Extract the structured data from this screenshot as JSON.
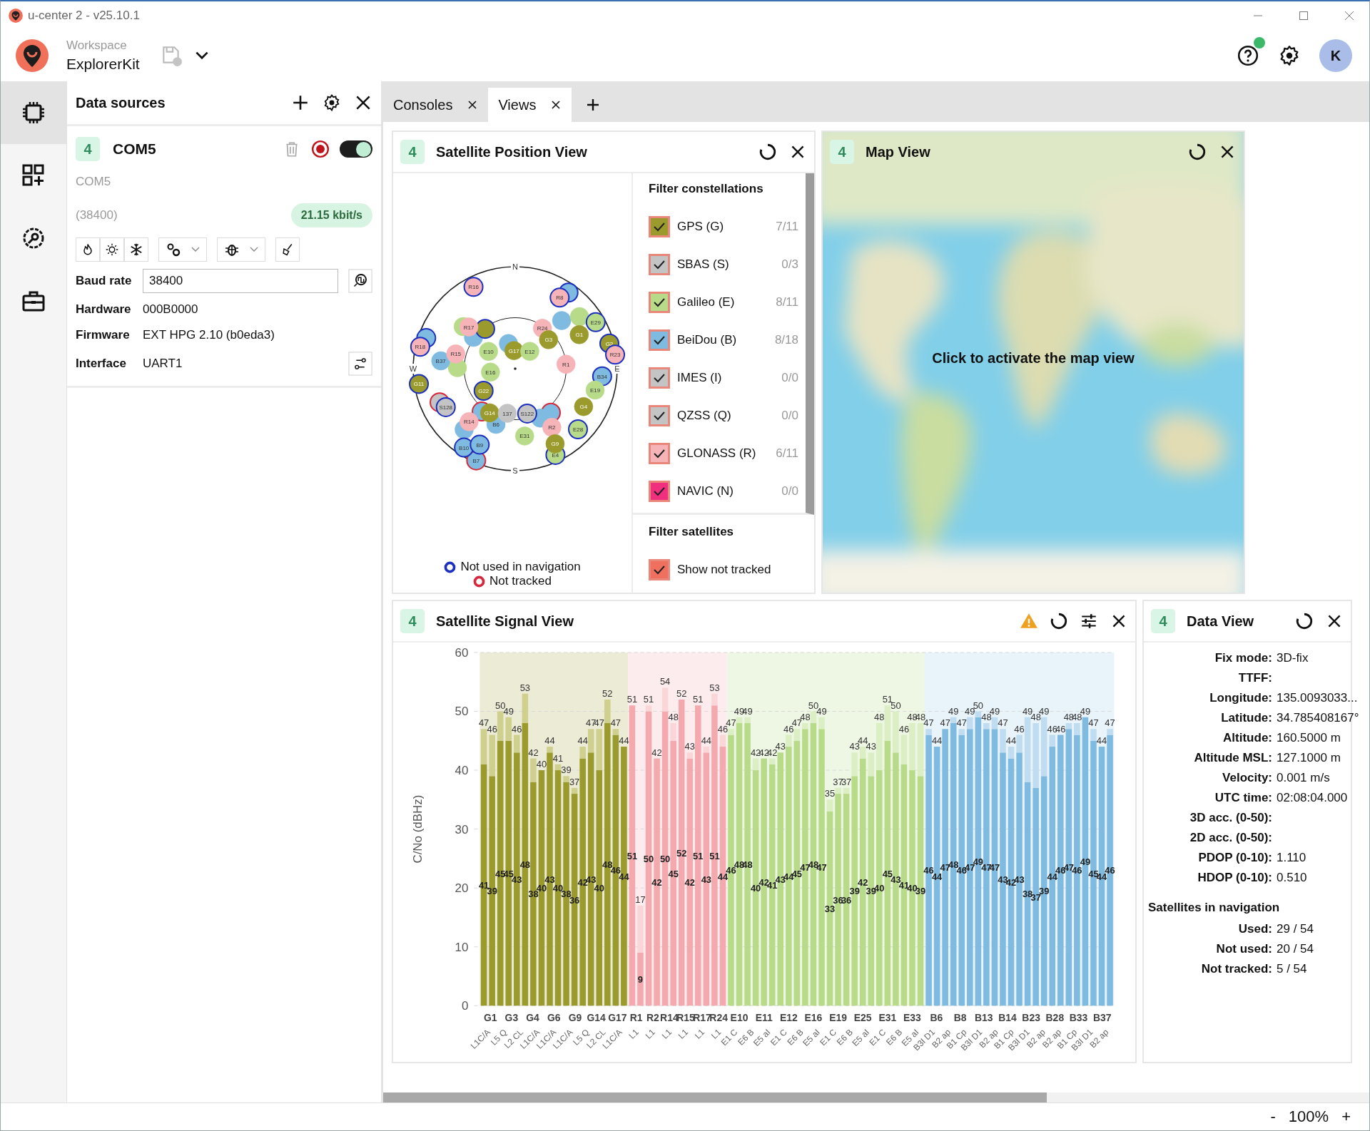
{
  "window": {
    "title": "u-center 2 - v25.10.1"
  },
  "header": {
    "workspace_label": "Workspace",
    "workspace_name": "ExplorerKit",
    "help_notification": true,
    "avatar": "K"
  },
  "rail": [
    {
      "kind": "devices",
      "selected": true
    },
    {
      "kind": "views",
      "selected": false
    },
    {
      "kind": "tools",
      "selected": false
    },
    {
      "kind": "toolbox",
      "selected": false
    }
  ],
  "data_sources": {
    "title": "Data sources",
    "device": {
      "badge": "4",
      "name": "COM5",
      "enabled": true,
      "port": "COM5",
      "baud_note": "(38400)",
      "rate": "21.15 kbit/s"
    },
    "fields": [
      {
        "label": "Baud rate",
        "value": "38400",
        "kind": "select"
      },
      {
        "label": "Hardware",
        "value": "000B0000",
        "kind": "text"
      },
      {
        "label": "Firmware",
        "value": "EXT HPG 2.10 (b0eda3)",
        "kind": "text"
      },
      {
        "label": "Interface",
        "value": "UART1",
        "kind": "action"
      }
    ]
  },
  "tabs": [
    {
      "label": "Consoles",
      "selected": false
    },
    {
      "label": "Views",
      "selected": true
    }
  ],
  "position_view": {
    "badge": "4",
    "title": "Satellite Position View",
    "sky_plot": {
      "directions": [
        "N",
        "E",
        "S",
        "W"
      ],
      "satellites": [
        {
          "color": "#7fbbe0",
          "used": false,
          "tracked": true
        },
        {
          "name": "R16",
          "color": "#f6b4b8",
          "used": false,
          "tracked": true
        },
        {
          "name": "R8",
          "color": "#f6b4b8",
          "used": false,
          "tracked": true
        },
        {
          "color": "#7fbbe0",
          "used": false,
          "tracked": true
        },
        {
          "name": "R18",
          "color": "#f6b4b8",
          "used": false,
          "tracked": true
        },
        {
          "color": "#b8db8a",
          "used": true,
          "tracked": true
        },
        {
          "color": "#7fbbe0",
          "used": true,
          "tracked": true
        },
        {
          "color": "#9b9a2c",
          "used": false,
          "tracked": true
        },
        {
          "name": "R17",
          "color": "#f6b4b8",
          "used": true,
          "tracked": true
        },
        {
          "color": "#b8db8a",
          "used": true,
          "tracked": true
        },
        {
          "name": "B37",
          "color": "#7fbbe0",
          "used": true,
          "tracked": true
        },
        {
          "name": "R15",
          "color": "#f6b4b8",
          "used": true,
          "tracked": true
        },
        {
          "color": "#7fbbe0",
          "used": true,
          "tracked": true
        },
        {
          "name": "E10",
          "color": "#b8db8a",
          "used": true,
          "tracked": true
        },
        {
          "name": "G17",
          "color": "#9b9a2c",
          "used": true,
          "tracked": true
        },
        {
          "name": "E12",
          "color": "#b8db8a",
          "used": true,
          "tracked": true
        },
        {
          "name": "R24",
          "color": "#f6b4b8",
          "used": true,
          "tracked": true
        },
        {
          "name": "G3",
          "color": "#9b9a2c",
          "used": true,
          "tracked": true
        },
        {
          "color": "#7fbbe0",
          "used": true,
          "tracked": true
        },
        {
          "color": "#b8db8a",
          "used": true,
          "tracked": true
        },
        {
          "name": "E29",
          "color": "#b8db8a",
          "used": false,
          "tracked": true
        },
        {
          "name": "G1",
          "color": "#9b9a2c",
          "used": true,
          "tracked": true
        },
        {
          "name": "R1",
          "color": "#f6b4b8",
          "used": true,
          "tracked": true
        },
        {
          "name": "G2",
          "color": "#9b9a2c",
          "used": false,
          "tracked": true
        },
        {
          "name": "R23",
          "color": "#f6b4b8",
          "used": false,
          "tracked": true
        },
        {
          "name": "B34",
          "color": "#7fbbe0",
          "used": false,
          "tracked": true
        },
        {
          "name": "G11",
          "color": "#9b9a2c",
          "used": false,
          "tracked": true
        },
        {
          "name": "E16",
          "color": "#b8db8a",
          "used": true,
          "tracked": true
        },
        {
          "name": "G22",
          "color": "#9b9a2c",
          "used": false,
          "tracked": true
        },
        {
          "name": "E19",
          "color": "#b8db8a",
          "used": true,
          "tracked": true
        },
        {
          "color": "#c4c4c4",
          "tracked": false
        },
        {
          "name": "S128",
          "color": "#c4c4c4",
          "used": false,
          "tracked": true
        },
        {
          "name": "G4",
          "color": "#9b9a2c",
          "used": true,
          "tracked": true
        },
        {
          "color": "#7fbbe0",
          "tracked": false
        },
        {
          "color": "#7fbbe0",
          "tracked": false
        },
        {
          "color": "#7fbbe0",
          "used": true,
          "tracked": true
        },
        {
          "color": "#7fbbe0",
          "used": true,
          "tracked": true
        },
        {
          "name": "B6",
          "color": "#7fbbe0",
          "used": true,
          "tracked": true
        },
        {
          "name": "G14",
          "color": "#9b9a2c",
          "used": true,
          "tracked": true
        },
        {
          "name": "137",
          "color": "#c4c4c4",
          "used": true,
          "tracked": true
        },
        {
          "name": "S122",
          "color": "#c4c4c4",
          "used": false,
          "tracked": true
        },
        {
          "name": "R14",
          "color": "#f6b4b8",
          "used": true,
          "tracked": true
        },
        {
          "name": "R2",
          "color": "#f6b4b8",
          "used": true,
          "tracked": true
        },
        {
          "name": "E28",
          "color": "#b8db8a",
          "used": false,
          "tracked": true
        },
        {
          "name": "E31",
          "color": "#b8db8a",
          "used": true,
          "tracked": true
        },
        {
          "name": "E4",
          "color": "#b8db8a",
          "used": false,
          "tracked": true
        },
        {
          "name": "G9",
          "color": "#9b9a2c",
          "used": true,
          "tracked": true
        },
        {
          "name": "B7",
          "color": "#7fbbe0",
          "tracked": false
        },
        {
          "name": "B10",
          "color": "#7fbbe0",
          "used": false,
          "tracked": true
        },
        {
          "name": "B9",
          "color": "#7fbbe0",
          "used": false,
          "tracked": true
        }
      ]
    },
    "legend": [
      {
        "label": "Not used in navigation",
        "kind": "not_used"
      },
      {
        "label": "Not tracked",
        "kind": "not_tracked"
      }
    ],
    "filter_constellations": {
      "title": "Filter constellations",
      "items": [
        {
          "label": "GPS (G)",
          "count": "7/11",
          "checked": true,
          "color": "#9b9a2c"
        },
        {
          "label": "SBAS (S)",
          "count": "0/3",
          "checked": true,
          "color": "#c4c4c4"
        },
        {
          "label": "Galileo (E)",
          "count": "8/11",
          "checked": true,
          "color": "#b8db8a"
        },
        {
          "label": "BeiDou (B)",
          "count": "8/18",
          "checked": true,
          "color": "#7fbbe0"
        },
        {
          "label": "IMES (I)",
          "count": "0/0",
          "checked": true,
          "color": "#c4c4c4"
        },
        {
          "label": "QZSS (Q)",
          "count": "0/0",
          "checked": true,
          "color": "#c4c4c4"
        },
        {
          "label": "GLONASS (R)",
          "count": "6/11",
          "checked": true,
          "color": "#f6b4b8"
        },
        {
          "label": "NAVIC (N)",
          "count": "0/0",
          "checked": true,
          "color": "#f0307f"
        }
      ]
    },
    "filter_satellites": {
      "title": "Filter satellites",
      "items": [
        {
          "label": "Show not tracked",
          "checked": true,
          "color": "#f07060"
        }
      ]
    }
  },
  "map_view": {
    "badge": "4",
    "title": "Map View",
    "overlay": "Click to activate the map view"
  },
  "signal_view": {
    "badge": "4",
    "title": "Satellite Signal View",
    "warning": true,
    "chart_data": {
      "type": "bar",
      "stacked": true,
      "grid": true,
      "ylabel": "C/No (dBHz)",
      "ylim": [
        0,
        60
      ],
      "yticks": [
        0,
        10,
        20,
        30,
        40,
        50,
        60
      ],
      "categories": [
        null,
        null,
        null,
        null,
        null,
        null,
        null,
        null,
        null,
        null,
        null,
        null,
        null,
        null,
        null,
        null,
        null,
        null,
        null,
        null,
        null,
        null,
        null,
        null,
        null,
        null,
        null,
        null,
        null,
        null,
        null,
        null,
        null,
        null,
        null,
        null,
        null,
        null,
        null,
        null,
        null,
        null,
        null,
        null,
        null,
        null,
        null,
        null,
        null,
        null,
        null,
        null,
        null,
        null,
        null,
        null,
        null,
        null,
        null,
        null,
        null,
        null,
        null,
        null,
        null,
        null,
        null,
        null,
        null,
        null,
        null,
        null,
        null,
        null,
        null,
        null,
        null
      ],
      "series": [
        {
          "color": "#9b9a2c",
          "values": [
            41,
            39,
            45,
            45,
            43,
            48,
            38,
            40,
            43,
            40,
            38,
            36,
            42,
            43,
            40,
            48,
            46,
            44,
            null,
            null,
            null,
            null,
            null,
            null,
            null,
            null,
            null,
            null,
            null,
            null,
            null,
            null,
            null,
            null,
            null,
            null,
            null,
            null,
            null,
            null,
            null,
            null,
            null,
            null,
            null,
            null,
            null,
            null,
            null,
            null,
            null,
            null,
            null,
            null,
            null,
            null,
            null,
            null,
            null,
            null,
            null,
            null,
            null,
            null,
            null,
            null,
            null,
            null,
            null,
            null,
            null,
            null,
            null,
            null,
            null,
            null,
            null
          ],
          "value_labels": [
            "41",
            "39",
            "45",
            "45",
            "43",
            "48",
            "38",
            "40",
            "43",
            "40",
            "38",
            "36",
            "42",
            "43",
            "40",
            "48",
            "46",
            "44",
            null,
            null,
            null,
            null,
            null,
            null,
            null,
            null,
            null,
            null,
            null,
            null,
            null,
            null,
            null,
            null,
            null,
            null,
            null,
            null,
            null,
            null,
            null,
            null,
            null,
            null,
            null,
            null,
            null,
            null,
            null,
            null,
            null,
            null,
            null,
            null,
            null,
            null,
            null,
            null,
            null,
            null,
            null,
            null,
            null,
            null,
            null,
            null,
            null,
            null,
            null,
            null,
            null,
            null,
            null,
            null,
            null,
            null,
            null
          ]
        },
        {
          "color": "#cfcf8e",
          "values": [
            6,
            7,
            5,
            4,
            3,
            5,
            4,
            0,
            1,
            1,
            1,
            1,
            2,
            4,
            7,
            4,
            1,
            0,
            null,
            null,
            null,
            null,
            null,
            null,
            null,
            null,
            null,
            null,
            null,
            null,
            null,
            null,
            null,
            null,
            null,
            null,
            null,
            null,
            null,
            null,
            null,
            null,
            null,
            null,
            null,
            null,
            null,
            null,
            null,
            null,
            null,
            null,
            null,
            null,
            null,
            null,
            null,
            null,
            null,
            null,
            null,
            null,
            null,
            null,
            null,
            null,
            null,
            null,
            null,
            null,
            null,
            null,
            null,
            null,
            null,
            null,
            null
          ]
        },
        {
          "color": "#f4a9ae",
          "values": [
            null,
            null,
            null,
            null,
            null,
            null,
            null,
            null,
            null,
            null,
            null,
            null,
            null,
            null,
            null,
            null,
            null,
            null,
            51,
            9,
            50,
            42,
            50,
            45,
            52,
            42,
            51,
            43,
            51,
            44,
            null,
            null,
            null,
            null,
            null,
            null,
            null,
            null,
            null,
            null,
            null,
            null,
            null,
            null,
            null,
            null,
            null,
            null,
            null,
            null,
            null,
            null,
            null,
            null,
            null,
            null,
            null,
            null,
            null,
            null,
            null,
            null,
            null,
            null,
            null,
            null,
            null,
            null,
            null,
            null,
            null,
            null,
            null,
            null,
            null,
            null,
            null
          ],
          "value_labels": [
            null,
            null,
            null,
            null,
            null,
            null,
            null,
            null,
            null,
            null,
            null,
            null,
            null,
            null,
            null,
            null,
            null,
            null,
            "51",
            "9",
            "50",
            "42",
            "50",
            "45",
            "52",
            "42",
            "51",
            "43",
            "51",
            "44",
            null,
            null,
            null,
            null,
            null,
            null,
            null,
            null,
            null,
            null,
            null,
            null,
            null,
            null,
            null,
            null,
            null,
            null,
            null,
            null,
            null,
            null,
            null,
            null,
            null,
            null,
            null,
            null,
            null,
            null,
            null,
            null,
            null,
            null,
            null,
            null,
            null,
            null,
            null,
            null,
            null,
            null,
            null,
            null,
            null,
            null,
            null
          ]
        },
        {
          "color": "#fbd6d8",
          "values": [
            null,
            null,
            null,
            null,
            null,
            null,
            null,
            null,
            null,
            null,
            null,
            null,
            null,
            null,
            null,
            null,
            null,
            null,
            0,
            8,
            1,
            0,
            4,
            3,
            0,
            1,
            0,
            1,
            2,
            2,
            null,
            null,
            null,
            null,
            null,
            null,
            null,
            null,
            null,
            null,
            null,
            null,
            null,
            null,
            null,
            null,
            null,
            null,
            null,
            null,
            null,
            null,
            null,
            null,
            null,
            null,
            null,
            null,
            null,
            null,
            null,
            null,
            null,
            null,
            null,
            null,
            null,
            null,
            null,
            null,
            null,
            null,
            null,
            null,
            null,
            null,
            null
          ]
        },
        {
          "color": "#b8db8a",
          "values": [
            null,
            null,
            null,
            null,
            null,
            null,
            null,
            null,
            null,
            null,
            null,
            null,
            null,
            null,
            null,
            null,
            null,
            null,
            null,
            null,
            null,
            null,
            null,
            null,
            null,
            null,
            null,
            null,
            null,
            null,
            46,
            48,
            48,
            40,
            42,
            41,
            43,
            44,
            45,
            47,
            48,
            47,
            33,
            36,
            36,
            39,
            42,
            39,
            40,
            45,
            43,
            41,
            40,
            39,
            null,
            null,
            null,
            null,
            null,
            null,
            null,
            null,
            null,
            null,
            null,
            null,
            null,
            null,
            null,
            null,
            null,
            null,
            null,
            null,
            null,
            null,
            null
          ],
          "value_labels": [
            null,
            null,
            null,
            null,
            null,
            null,
            null,
            null,
            null,
            null,
            null,
            null,
            null,
            null,
            null,
            null,
            null,
            null,
            null,
            null,
            null,
            null,
            null,
            null,
            null,
            null,
            null,
            null,
            null,
            null,
            "46",
            "48",
            "48",
            "40",
            "42",
            "41",
            "43",
            "44",
            "45",
            "47",
            "48",
            "47",
            "33",
            "36",
            "36",
            "39",
            "42",
            "39",
            "40",
            "45",
            "43",
            "41",
            "40",
            "39",
            null,
            null,
            null,
            null,
            null,
            null,
            null,
            null,
            null,
            null,
            null,
            null,
            null,
            null,
            null,
            null,
            null,
            null,
            null,
            null,
            null,
            null,
            null
          ]
        },
        {
          "color": "#dbeec4",
          "values": [
            null,
            null,
            null,
            null,
            null,
            null,
            null,
            null,
            null,
            null,
            null,
            null,
            null,
            null,
            null,
            null,
            null,
            null,
            null,
            null,
            null,
            null,
            null,
            null,
            null,
            null,
            null,
            null,
            null,
            null,
            1,
            1,
            1,
            2,
            0,
            1,
            0,
            2,
            2,
            1,
            2,
            2,
            2,
            1,
            1,
            4,
            2,
            4,
            8,
            6,
            7,
            5,
            8,
            9,
            null,
            null,
            null,
            null,
            null,
            null,
            null,
            null,
            null,
            null,
            null,
            null,
            null,
            null,
            null,
            null,
            null,
            null,
            null,
            null,
            null,
            null,
            null
          ]
        },
        {
          "color": "#7fbbe0",
          "values": [
            null,
            null,
            null,
            null,
            null,
            null,
            null,
            null,
            null,
            null,
            null,
            null,
            null,
            null,
            null,
            null,
            null,
            null,
            null,
            null,
            null,
            null,
            null,
            null,
            null,
            null,
            null,
            null,
            null,
            null,
            null,
            null,
            null,
            null,
            null,
            null,
            null,
            null,
            null,
            null,
            null,
            null,
            null,
            null,
            null,
            null,
            null,
            null,
            null,
            null,
            null,
            null,
            null,
            null,
            46,
            44,
            47,
            48,
            46,
            47,
            49,
            47,
            47,
            43,
            42,
            43,
            38,
            37,
            39,
            44,
            46,
            47,
            46,
            49,
            45,
            44,
            46
          ],
          "value_labels": [
            null,
            null,
            null,
            null,
            null,
            null,
            null,
            null,
            null,
            null,
            null,
            null,
            null,
            null,
            null,
            null,
            null,
            null,
            null,
            null,
            null,
            null,
            null,
            null,
            null,
            null,
            null,
            null,
            null,
            null,
            null,
            null,
            null,
            null,
            null,
            null,
            null,
            null,
            null,
            null,
            null,
            null,
            null,
            null,
            null,
            null,
            null,
            null,
            null,
            null,
            null,
            null,
            null,
            null,
            "46",
            "44",
            "47",
            "48",
            "46",
            "47",
            "49",
            "47",
            "47",
            "43",
            "42",
            "43",
            "38",
            "37",
            "39",
            "44",
            "46",
            "47",
            "46",
            "49",
            "45",
            "44",
            "46"
          ]
        },
        {
          "color": "#bfdcf0",
          "values": [
            null,
            null,
            null,
            null,
            null,
            null,
            null,
            null,
            null,
            null,
            null,
            null,
            null,
            null,
            null,
            null,
            null,
            null,
            null,
            null,
            null,
            null,
            null,
            null,
            null,
            null,
            null,
            null,
            null,
            null,
            null,
            null,
            null,
            null,
            null,
            null,
            null,
            null,
            null,
            null,
            null,
            null,
            null,
            null,
            null,
            null,
            null,
            null,
            null,
            null,
            null,
            null,
            null,
            null,
            1,
            0,
            0,
            1,
            1,
            2,
            1,
            1,
            2,
            4,
            2,
            3,
            11,
            11,
            10,
            2,
            0,
            1,
            2,
            0,
            2,
            0,
            1
          ]
        }
      ]
    },
    "peak_labels": [
      "47",
      "46",
      "50",
      "49",
      "46",
      "53",
      "42",
      "40",
      "44",
      "41",
      "39",
      "37",
      "44",
      "47",
      "47",
      "52",
      "47",
      "44",
      "51",
      "17",
      "51",
      "42",
      "54",
      "48",
      "52",
      "43",
      "51",
      "44",
      "53",
      "46",
      "47",
      "49",
      "49",
      "42",
      "42",
      "42",
      "43",
      "46",
      "47",
      "48",
      "50",
      "49",
      "35",
      "37",
      "37",
      "43",
      "44",
      "43",
      "48",
      "51",
      "50",
      "46",
      "48",
      "48",
      "47",
      "44",
      "47",
      "49",
      "47",
      "49",
      "50",
      "48",
      "49",
      "47",
      "44",
      "46",
      "49",
      "48",
      "49",
      "46",
      "46",
      "48",
      "48",
      "49",
      "47",
      "44",
      "47"
    ],
    "x_axis": [
      {
        "satellites": [
          "G1",
          "G3",
          "G4",
          "G6",
          "G9",
          "G14",
          "G17"
        ],
        "signals": [
          "L1C/A",
          "L5 Q",
          "L2 CL",
          "L1C/A",
          "L1C/A",
          "L1C/A",
          "L5 Q",
          "L2 CL",
          "L1C/A"
        ]
      },
      {
        "satellites": [
          "R1",
          "R2",
          "R14",
          "R15",
          "R17",
          "R24"
        ],
        "signals": [
          "L1",
          "L1",
          "L1",
          "L1",
          "L1",
          "L1"
        ]
      },
      {
        "satellites": [
          "E10",
          "E11",
          "E12",
          "E16",
          "E19",
          "E25",
          "E31",
          "E33"
        ],
        "signals": [
          "E1 C",
          "E6 B",
          "E5 aI",
          "E1 C",
          "E6 B",
          "E5 aI",
          "E1 C",
          "E6 B",
          "E5 aI",
          "E1 C",
          "E6 B",
          "E5 aI"
        ]
      },
      {
        "satellites": [
          "B6",
          "B8",
          "B13",
          "B14",
          "B23",
          "B28",
          "B33",
          "B37"
        ],
        "signals": [
          "B3I D1",
          "B2 ap",
          "B1 Cp",
          "B3I D1",
          "B2 ap",
          "B1 Cp",
          "B3I D1",
          "B2 ap",
          "B2 ap",
          "B1 Cp",
          "B3I D1",
          "B2 ap"
        ]
      }
    ]
  },
  "data_view": {
    "badge": "4",
    "title": "Data View",
    "rows": [
      {
        "label": "Fix mode:",
        "value": "3D-fix"
      },
      {
        "label": "TTFF:"
      },
      {
        "label": "Longitude:",
        "value": "135.0093033..."
      },
      {
        "label": "Latitude:",
        "value": "34.785408167°"
      },
      {
        "label": "Altitude:",
        "value": "160.5000 m"
      },
      {
        "label": "Altitude MSL:",
        "value": "127.1000 m"
      },
      {
        "label": "Velocity:",
        "value": "0.001 m/s"
      },
      {
        "label": "UTC time:",
        "value": "02:08:04.000"
      },
      {
        "label": "3D acc. (0-50):"
      },
      {
        "label": "2D acc. (0-50):"
      },
      {
        "label": "PDOP (0-10):",
        "value": "1.110"
      },
      {
        "label": "HDOP (0-10):",
        "value": "0.510"
      }
    ],
    "section": "Satellites in navigation",
    "nav_rows": [
      {
        "label": "Used:",
        "value": "29 / 54"
      },
      {
        "label": "Not used:",
        "value": "20 / 54"
      },
      {
        "label": "Not tracked:",
        "value": "5 / 54"
      }
    ]
  },
  "status_bar": {
    "zoom_out": "-",
    "zoom": "100%",
    "zoom_in": "+"
  }
}
